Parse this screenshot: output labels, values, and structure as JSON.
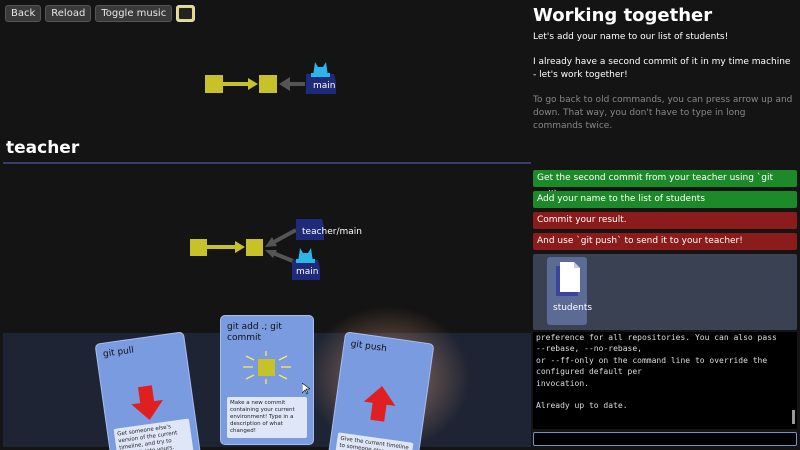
{
  "toolbar": {
    "back": "Back",
    "reload": "Reload",
    "toggle_music": "Toggle music"
  },
  "top_graph": {
    "branch": "main"
  },
  "teacher": {
    "title": "teacher",
    "branch_main": "teacher/main",
    "branch_local": "main"
  },
  "cards": [
    {
      "title": "git pull",
      "desc": "Get someone else's version of the current timeline, and try to merge it into yours.",
      "icon": "down-arrow-icon"
    },
    {
      "title": "git add .; git commit",
      "desc": "Make a new commit containing your current environment! Type in a description of what changed!",
      "icon": "commit-sparkle-icon"
    },
    {
      "title": "git push",
      "desc": "Give the current timeline to someone else.",
      "icon": "up-arrow-icon"
    }
  ],
  "level": {
    "title": "Working together",
    "p1": "Let's add your name to our list of students!",
    "p2": "I already have a second commit of it in my time machine - let's work together!",
    "p3": "To go back to old commands, you can press arrow up and down. That way, you don't have to type in long commands twice."
  },
  "tasks": [
    {
      "text": "Get the second commit from your teacher using `git pull`.",
      "status": "done"
    },
    {
      "text": "Add your name to the list of students",
      "status": "done"
    },
    {
      "text": "Commit your result.",
      "status": "todo"
    },
    {
      "text": "And use `git push` to send it to your teacher!",
      "status": "todo"
    }
  ],
  "files": [
    {
      "name": "students"
    }
  ],
  "terminal": {
    "output": "preference for all repositories. You can also pass\n--rebase, --no-rebase,\nor --ff-only on the command line to override the\nconfigured default per\ninvocation.\n\nAlready up to date."
  },
  "colors": {
    "commit": "#c8c22a",
    "branch_bg": "#1f2a7a",
    "head": "#2cb5e8",
    "task_done": "#1c8a28",
    "task_todo": "#8c1c1c"
  }
}
